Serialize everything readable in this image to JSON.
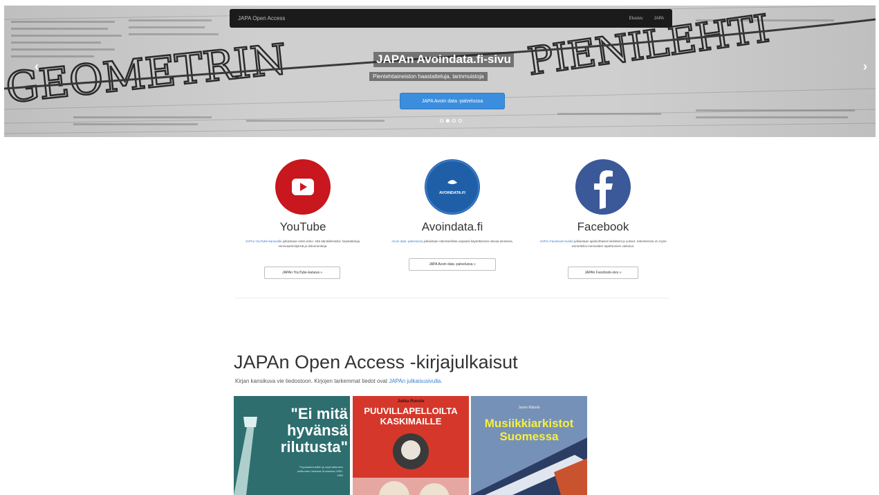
{
  "navbar": {
    "brand": "JAPA Open Access",
    "links": [
      "Etusivu",
      "JAPA"
    ]
  },
  "hero": {
    "title": "JAPAn Avoindata.fi-sivu",
    "subtitle": "Pientehtiaineiston haastatteluja, tarinmuistoja",
    "cta": "JAPA Avoin data -palvelussa",
    "indicator_count": 4,
    "active_indicator": 1,
    "background_word": "GEOMETRIN PIENILEHTI"
  },
  "services": [
    {
      "title": "YouTube",
      "icon": "youtube-icon",
      "link_text": "JAPAn YouTube-kanavalla",
      "desc": "julkaistaan sekä video- että äänitallenteita: haastatteluja, seminaariesityksiä ja dokumentteja.",
      "button": "JAPAn YouTube-kanava »",
      "color": "#c8171e"
    },
    {
      "title": "Avoindata.fi",
      "icon": "avoindata-icon",
      "icon_text": "AVOINDATA.FI",
      "link_text": "Avoin data -palvelussa",
      "desc": "julkaistaan rakenteellista vapaasti käytettävissä olevaa aineistoa.",
      "button": "JAPA Avoin data -palvelussa »",
      "color": "#1f5fa8"
    },
    {
      "title": "Facebook",
      "icon": "facebook-icon",
      "link_text": "JAPAn Facebook-sivulla",
      "desc": "julkaistaan ajankohtaiset tiedotteet ja uutiset. Kalenterissa on myös esimerkiksi menneiden tapahtumien vaikutus.",
      "button": "JAPAn Facebook-sivu »",
      "color": "#3b5998"
    }
  ],
  "books": {
    "title": "JAPAn Open Access -kirjajulkaisut",
    "subtitle": "Kirjan kansikuva vie tiedostoon. Kirjojen tarkemmat tiedot ovat ",
    "subtitle_link": "JAPAn julkaisusivulla.",
    "items": [
      {
        "title": "\"Ei mitä hyvänsä rilutusta\"",
        "subtitle": "Populaarimusiikin ja sopimattomien kulttuurien historiaa Suomessa 1950-1980"
      },
      {
        "author": "Jukka Ruoste",
        "title": "PUUVILLAPELLOILTA KASKIMAILLE"
      },
      {
        "author": "Janne Mäkelä",
        "title": "Musiikkiarkistot Suomessa"
      }
    ]
  }
}
